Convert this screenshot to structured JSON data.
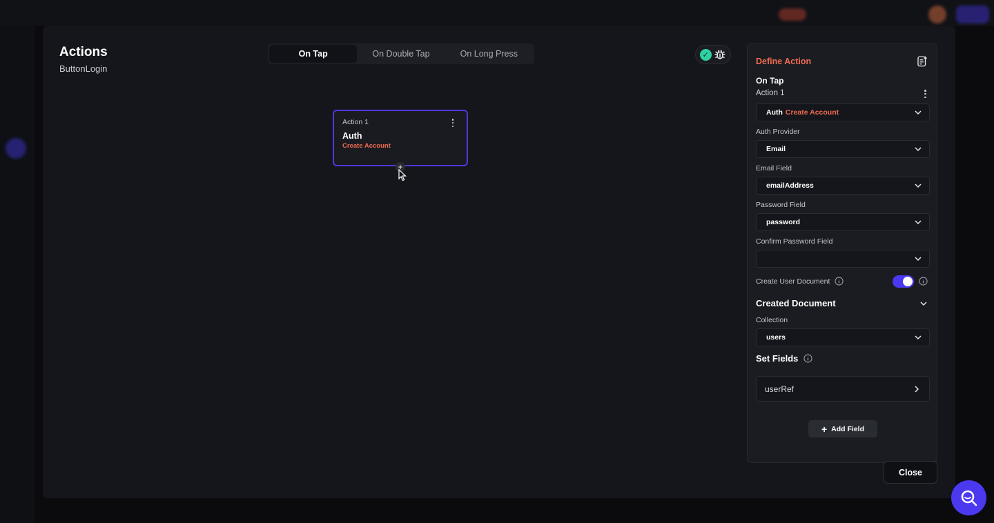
{
  "modal": {
    "title": "Actions",
    "subtitle": "ButtonLogin",
    "tabs": [
      {
        "label": "On Tap",
        "active": true
      },
      {
        "label": "On Double Tap",
        "active": false
      },
      {
        "label": "On Long Press",
        "active": false
      }
    ],
    "close_label": "Close"
  },
  "card": {
    "number": "Action 1",
    "title": "Auth",
    "subtitle": "Create Account",
    "plus_label": "+"
  },
  "panel": {
    "heading": "Define Action",
    "trigger": "On Tap",
    "action_number": "Action 1",
    "action_select": {
      "type": "Auth",
      "name": "Create Account"
    },
    "auth_provider": {
      "label": "Auth Provider",
      "value": "Email"
    },
    "email_field": {
      "label": "Email Field",
      "value": "emailAddress"
    },
    "password_field": {
      "label": "Password Field",
      "value": "password"
    },
    "confirm_password_field": {
      "label": "Confirm Password Field",
      "value": ""
    },
    "create_user_document": {
      "label": "Create User Document",
      "enabled": true
    },
    "created_document": {
      "title": "Created Document"
    },
    "collection": {
      "label": "Collection",
      "value": "users"
    },
    "set_fields": {
      "title": "Set Fields",
      "items": [
        "userRef"
      ]
    },
    "add_field_label": "Add Field"
  },
  "colors": {
    "accent": "#4b39ef",
    "highlight": "#ef6b50",
    "success": "#2ed1a3"
  }
}
